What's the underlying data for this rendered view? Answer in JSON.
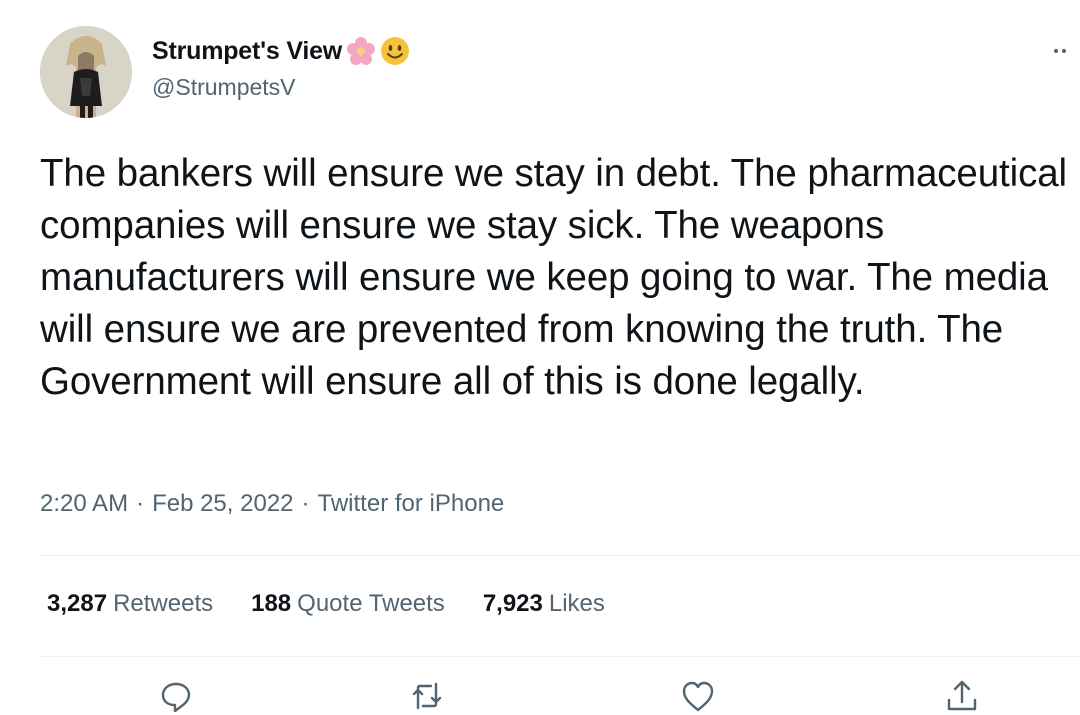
{
  "author": {
    "display_name": "Strumpet's View",
    "handle": "@StrumpetsV",
    "name_emojis": [
      "cherry-blossom-emoji",
      "smiling-face-emoji"
    ]
  },
  "tweet": {
    "text": "The bankers will ensure we stay in debt. The pharmaceutical companies will ensure we stay sick. The weapons manufacturers will ensure we keep going to war. The media will ensure we are prevented from knowing the truth. The Government will ensure all of this is done legally.",
    "time": "2:20 AM",
    "date": "Feb 25, 2022",
    "source": "Twitter for iPhone",
    "separator": "·"
  },
  "stats": {
    "retweets_count": "3,287",
    "retweets_label": "Retweets",
    "quotes_count": "188",
    "quotes_label": "Quote Tweets",
    "likes_count": "7,923",
    "likes_label": "Likes"
  },
  "actions": [
    "reply-icon",
    "retweet-icon",
    "like-icon",
    "share-icon"
  ],
  "colors": {
    "text_primary": "#0f1419",
    "text_secondary": "#536471",
    "divider": "#eff3f4",
    "emoji_yellow": "#f5c33b",
    "emoji_pink": "#f4a7c3"
  }
}
